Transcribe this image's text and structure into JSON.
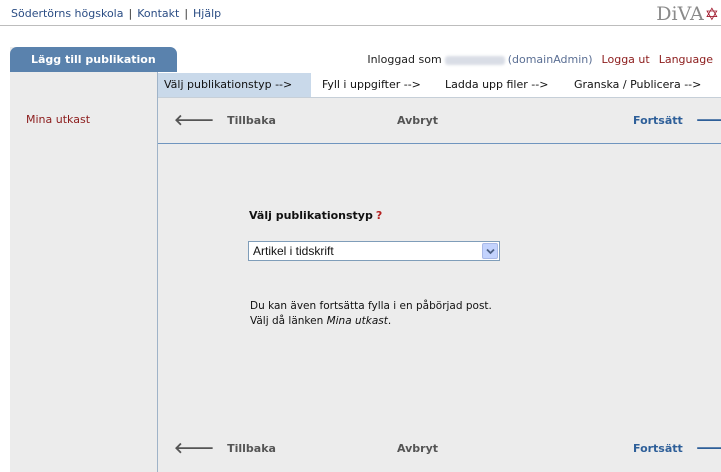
{
  "top_links": [
    "Södertörns högskola",
    "Kontakt",
    "Hjälp"
  ],
  "logo": {
    "text": "DiVA",
    "star": "✡"
  },
  "sidebar": {
    "tab_label": "Lägg till publikation",
    "drafts_link": "Mina utkast"
  },
  "user": {
    "logged_in_as": "Inloggad som",
    "role": "(domainAdmin)",
    "logout": "Logga ut",
    "language": "Language"
  },
  "steps": [
    "Välj publikationstyp -->",
    "Fyll i uppgifter -->",
    "Ladda upp filer -->",
    "Granska / Publicera -->"
  ],
  "active_step": 0,
  "nav": {
    "back": "Tillbaka",
    "cancel": "Avbryt",
    "continue": "Fortsätt",
    "back_arrow": "🡐",
    "forward_arrow": "🡒"
  },
  "form": {
    "type_label": "Välj publikationstyp",
    "help_marker": "?",
    "selected_type": "Artikel i tidskrift"
  },
  "info": {
    "line1": "Du kan även fortsätta fylla i en påbörjad post.",
    "line2_prefix": "Välj då länken ",
    "line2_link": "Mina utkast",
    "line2_suffix": "."
  },
  "colors": {
    "sidebar_tab": "#5a82ad",
    "link_red": "#8c1c1c",
    "link_blue": "#2b4d84",
    "active_step_bg": "#c9d9ea",
    "panel_bg": "#ececec"
  }
}
